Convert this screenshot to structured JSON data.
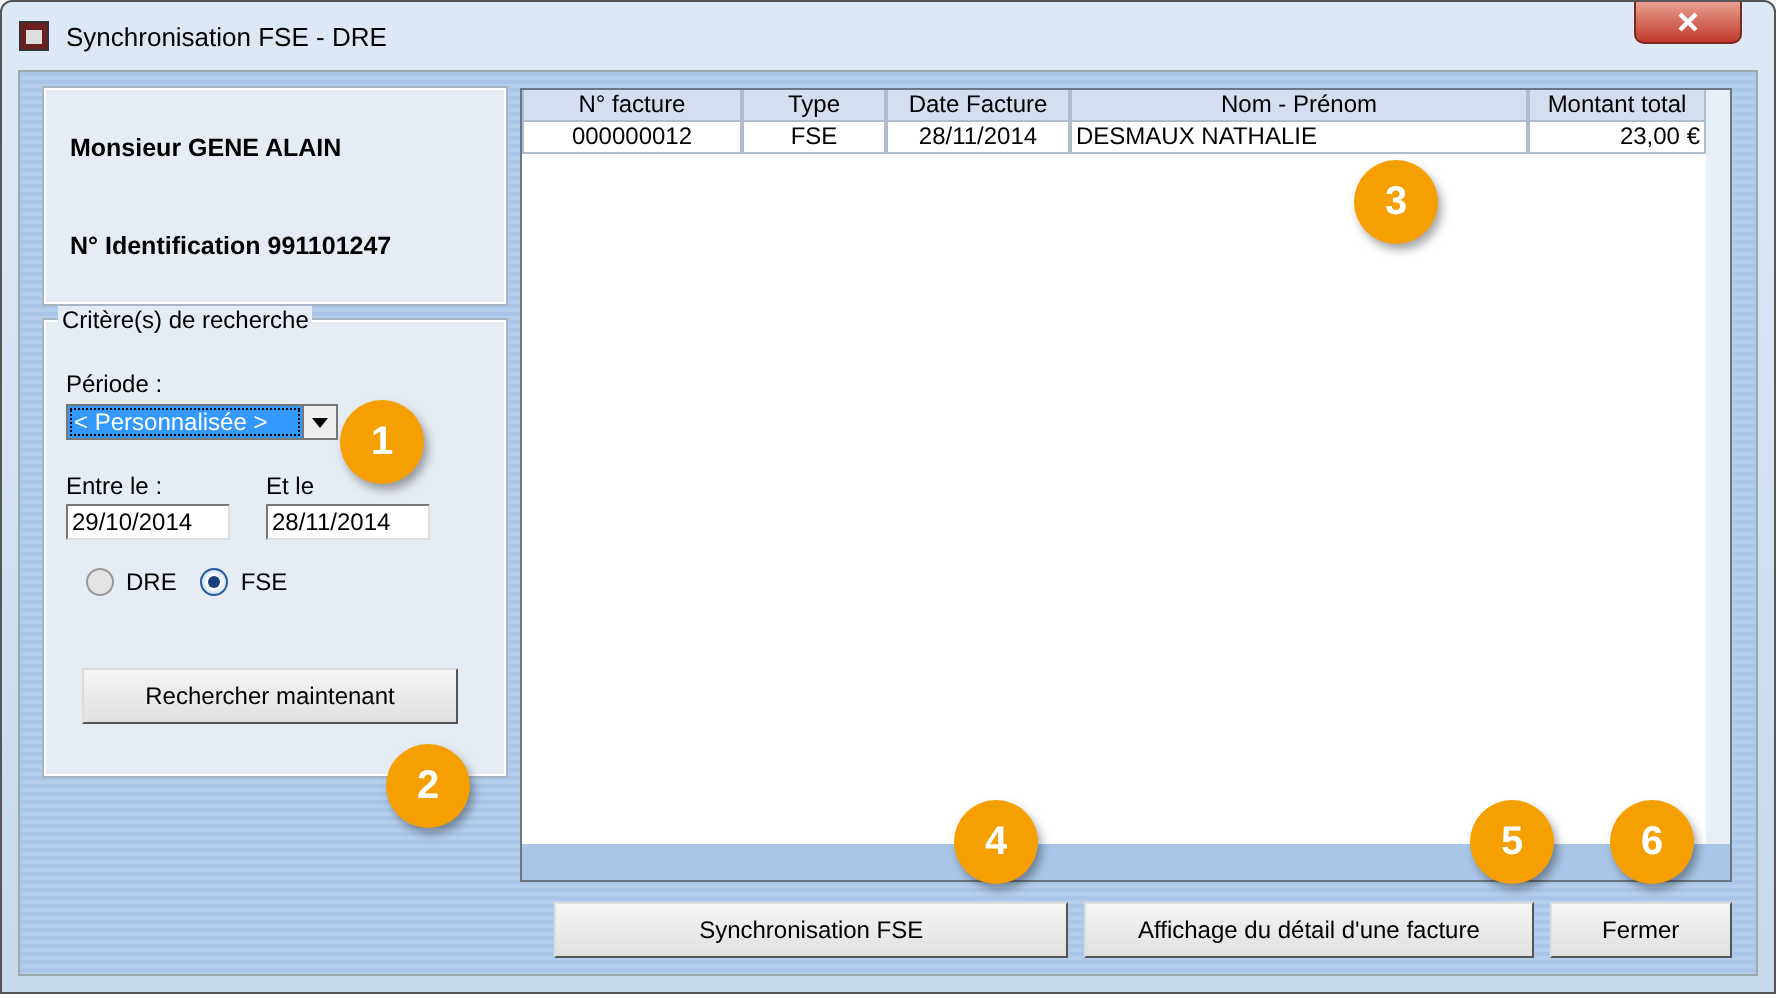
{
  "window": {
    "title": "Synchronisation FSE - DRE"
  },
  "info": {
    "name": "Monsieur GENE ALAIN",
    "identification": "N° Identification 991101247"
  },
  "criteria": {
    "title": "Critère(s) de recherche",
    "period_label": "Période :",
    "period_value": "< Personnalisée >",
    "from_label": "Entre le :",
    "from_value": "29/10/2014",
    "to_label": "Et le",
    "to_value": "28/11/2014",
    "radios": [
      {
        "label": "DRE",
        "selected": false
      },
      {
        "label": "FSE",
        "selected": true
      }
    ],
    "search_button": "Rechercher maintenant"
  },
  "table": {
    "columns": [
      "N° facture",
      "Type",
      "Date Facture",
      "Nom - Prénom",
      "Montant total"
    ],
    "rows": [
      [
        "000000012",
        "FSE",
        "28/11/2014",
        "DESMAUX NATHALIE",
        "23,00 €"
      ]
    ]
  },
  "buttons": [
    "Synchronisation FSE",
    "Affichage du détail d'une facture",
    "Fermer"
  ],
  "badges": [
    "1",
    "2",
    "3",
    "4",
    "5",
    "6"
  ]
}
